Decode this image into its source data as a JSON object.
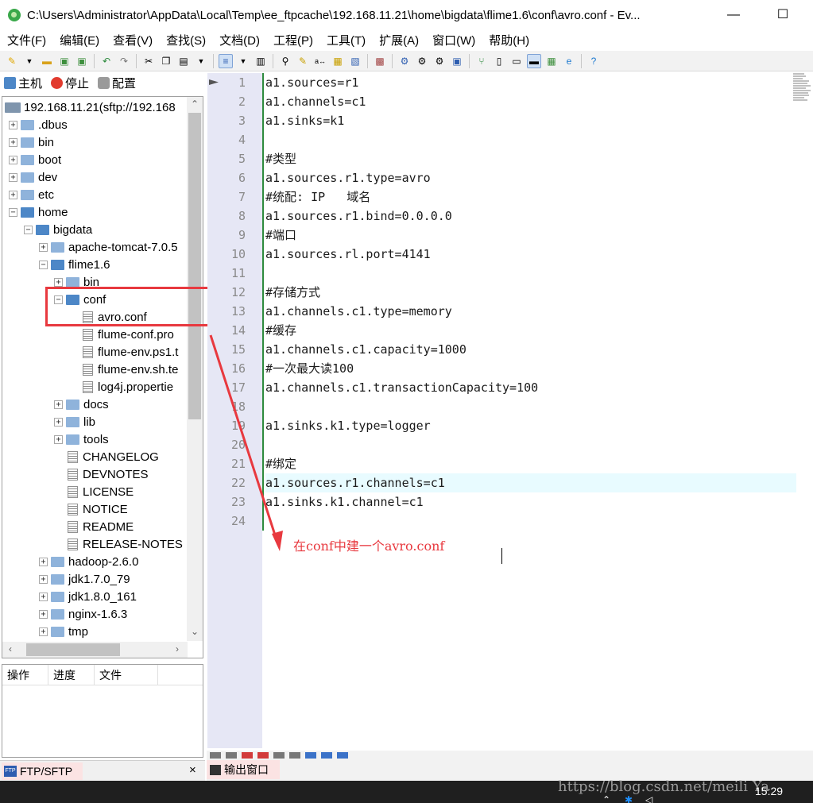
{
  "window": {
    "title": "C:\\Users\\Administrator\\AppData\\Local\\Temp\\ee_ftpcache\\192.168.11.21\\home\\bigdata\\flime1.6\\conf\\avro.conf - Ev..."
  },
  "menu": [
    "文件(F)",
    "编辑(E)",
    "查看(V)",
    "查找(S)",
    "文档(D)",
    "工程(P)",
    "工具(T)",
    "扩展(A)",
    "窗口(W)",
    "帮助(H)"
  ],
  "sidebar_tools": {
    "host": "主机",
    "stop": "停止",
    "config": "配置"
  },
  "tree": {
    "root": "192.168.11.21(sftp://192.168",
    "items": [
      ".dbus",
      "bin",
      "boot",
      "dev",
      "etc",
      "home",
      "bigdata",
      "apache-tomcat-7.0.5",
      "flime1.6",
      "bin",
      "conf",
      "avro.conf",
      "flume-conf.pro",
      "flume-env.ps1.t",
      "flume-env.sh.te",
      "log4j.propertie",
      "docs",
      "lib",
      "tools",
      "CHANGELOG",
      "DEVNOTES",
      "LICENSE",
      "NOTICE",
      "README",
      "RELEASE-NOTES",
      "hadoop-2.6.0",
      "jdk1.7.0_79",
      "jdk1.8.0_161",
      "nginx-1.6.3",
      "tmp"
    ]
  },
  "ops_panel": {
    "columns": [
      "操作",
      "进度",
      "文件"
    ]
  },
  "left_tab": {
    "badge": "FTP",
    "label": "FTP/SFTP",
    "close": "×"
  },
  "editor": {
    "line_numbers": [
      "1",
      "2",
      "3",
      "4",
      "5",
      "6",
      "7",
      "8",
      "9",
      "10",
      "11",
      "12",
      "13",
      "14",
      "15",
      "16",
      "17",
      "18",
      "19",
      "20",
      "21",
      "22",
      "23",
      "24"
    ],
    "lines": [
      "a1.sources=r1",
      "a1.channels=c1",
      "a1.sinks=k1",
      "",
      "#类型",
      "a1.sources.r1.type=avro",
      "#统配: IP   域名",
      "a1.sources.r1.bind=0.0.0.0",
      "#端口",
      "a1.sources.rl.port=4141",
      "",
      "#存储方式",
      "a1.channels.c1.type=memory",
      "#缓存",
      "a1.channels.c1.capacity=1000",
      "#一次最大读100",
      "a1.channels.c1.transactionCapacity=100",
      "",
      "a1.sinks.k1.type=logger",
      "",
      "#绑定",
      "a1.sources.r1.channels=c1",
      "a1.sinks.k1.channel=c1",
      ""
    ]
  },
  "annotation": "在conf中建一个avro.conf",
  "output_tab": "输出窗口",
  "watermark": "https://blog.csdn.net/meili Ya",
  "clock": "15:29",
  "colors": {
    "annotation": "#e8393f",
    "gutter": "#e6e7f5",
    "change_bar": "#2e8b3e"
  }
}
